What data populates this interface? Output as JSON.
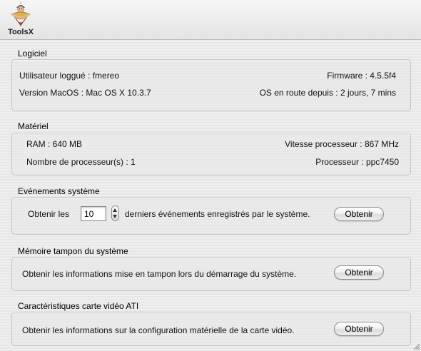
{
  "toolbar": {
    "item_label": "ToolsX",
    "item_icon": "toolsx-genie-icon"
  },
  "logiciel": {
    "title": "Logiciel",
    "user": "Utilisateur loggué : fmereo",
    "firmware": "Firmware : 4.5.5f4",
    "version": "Version MacOS : Mac OS X 10.3.7",
    "uptime": "OS en route depuis :  2 jours, 7 mins"
  },
  "materiel": {
    "title": "Matériel",
    "ram": "RAM : 640 MB",
    "speed": "Vitesse processeur : 867 MHz",
    "cpu_count": "Nombre de processeur(s) : 1",
    "cpu": "Processeur : ppc7450"
  },
  "events": {
    "title": "Evénements système",
    "prefix": "Obtenir les",
    "count_value": "10",
    "suffix": "derniers événements enregistrés par le système.",
    "button": "Obtenir"
  },
  "buffer": {
    "title": "Mémoire tampon du système",
    "text": "Obtenir les informations mise en tampon lors du démarrage du système.",
    "button": "Obtenir"
  },
  "video": {
    "title": "Caractéristiques carte vidéo ATI",
    "text": "Obtenir les informations sur la configuration matérielle de la carte vidéo.",
    "button": "Obtenir"
  }
}
